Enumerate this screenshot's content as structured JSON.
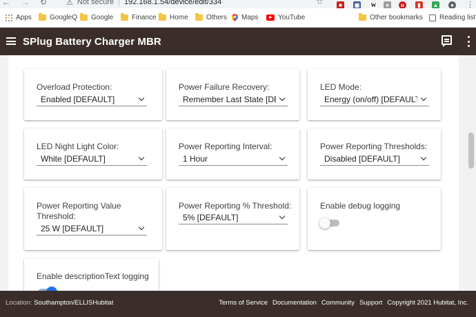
{
  "browser": {
    "not_secure": "Not secure",
    "url": "192.168.1.54/device/edit/334",
    "bookmarks": [
      {
        "label": "Apps",
        "icon": "apps-grid-icon"
      },
      {
        "label": "GoogleQ",
        "icon": "folder-icon"
      },
      {
        "label": "Google",
        "icon": "folder-icon"
      },
      {
        "label": "Finance",
        "icon": "folder-icon"
      },
      {
        "label": "Home",
        "icon": "folder-icon"
      },
      {
        "label": "Others",
        "icon": "folder-icon"
      },
      {
        "label": "Maps",
        "icon": "maps-icon"
      },
      {
        "label": "YouTube",
        "icon": "youtube-icon"
      }
    ],
    "other_bookmarks": "Other bookmarks",
    "reading_list": "Reading list"
  },
  "appbar": {
    "title": "SPlug Battery Charger MBR",
    "bg_color": "#3b2e2a"
  },
  "settings": [
    {
      "label": "Overload Protection:",
      "value": "Enabled [DEFAULT]",
      "type": "select"
    },
    {
      "label": "Power Failure Recovery:",
      "value": "Remember Last State [DEFAULT]",
      "type": "select"
    },
    {
      "label": "LED Mode:",
      "value": "Energy (on/off) [DEFAULT]",
      "type": "select"
    },
    {
      "label": "LED Night Light Color:",
      "value": "White [DEFAULT]",
      "type": "select"
    },
    {
      "label": "Power Reporting Interval:",
      "value": "1 Hour",
      "type": "select"
    },
    {
      "label": "Power Reporting Thresholds:",
      "value": "Disabled [DEFAULT]",
      "type": "select"
    },
    {
      "label": "Power Reporting Value Threshold:",
      "value": "25 W [DEFAULT]",
      "type": "select"
    },
    {
      "label": "Power Reporting % Threshold:",
      "value": "5% [DEFAULT]",
      "type": "select"
    },
    {
      "label": "Enable debug logging",
      "value": false,
      "type": "toggle"
    },
    {
      "label": "Enable descriptionText logging",
      "value": true,
      "type": "toggle"
    }
  ],
  "footer": {
    "location_label": "Location:",
    "location_value": "Southampton/ELLISHubitat",
    "links": [
      "Terms of Service",
      "Documentation",
      "Community",
      "Support",
      "Copyright 2021 Hubitat, Inc."
    ]
  }
}
